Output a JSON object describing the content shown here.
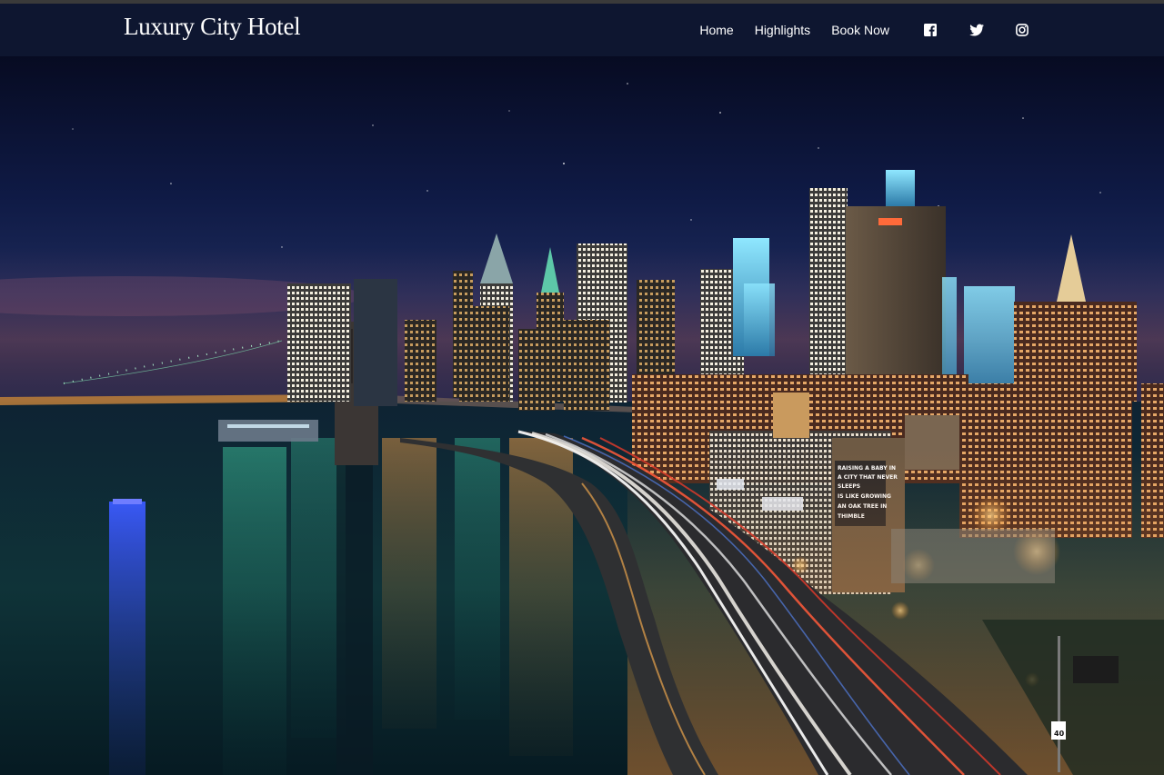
{
  "brand": {
    "name": "Luxury City Hotel"
  },
  "nav": {
    "links": [
      {
        "label": "Home"
      },
      {
        "label": "Highlights"
      },
      {
        "label": "Book Now"
      }
    ],
    "social": [
      {
        "icon": "facebook-icon"
      },
      {
        "icon": "twitter-icon"
      },
      {
        "icon": "instagram-icon"
      }
    ]
  },
  "hero": {
    "image": "night-city-skyline-photo",
    "billboard_lines": [
      "RAISING A BABY IN",
      "A CITY THAT NEVER",
      "SLEEPS",
      "IS LIKE GROWING",
      "AN OAK TREE IN",
      "THIMBLE"
    ],
    "speed_sign": "40"
  },
  "colors": {
    "navbar_bg": "#0e1630",
    "nav_text": "#ffffff",
    "sky_top": "#0a0f2a",
    "water": "#0d2a33"
  }
}
